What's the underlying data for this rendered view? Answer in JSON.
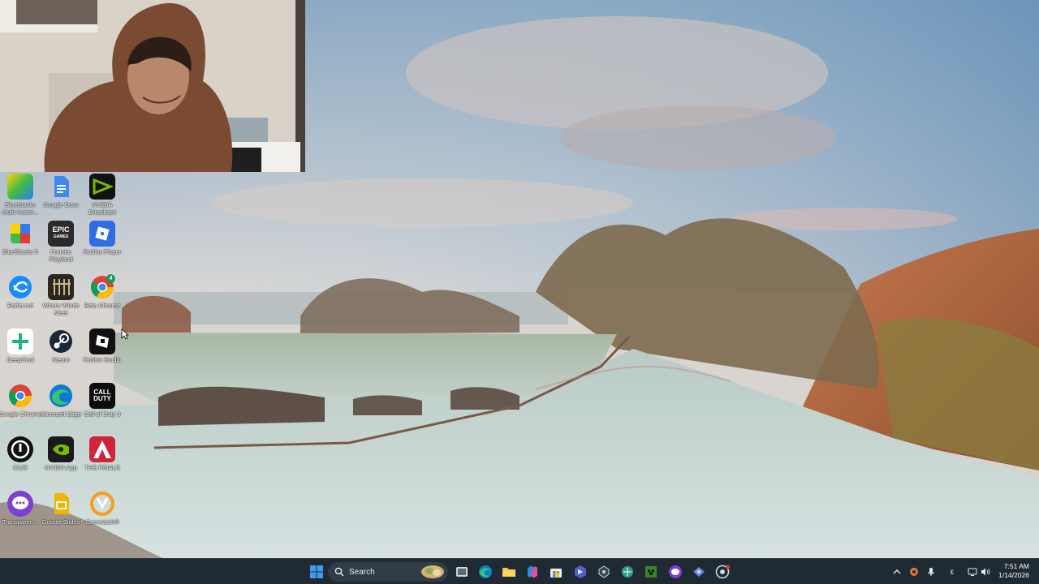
{
  "desktop": {
    "icons": [
      {
        "label": "BlueStacks Multi-Instan...",
        "icon": "bluestacks-multi-icon"
      },
      {
        "label": "Google Docs",
        "icon": "google-docs-icon"
      },
      {
        "label": "NVIDIA Broadcast",
        "icon": "nvidia-broadcast-icon"
      },
      {
        "label": "BlueStacks 5",
        "icon": "bluestacks-icon"
      },
      {
        "label": "Fortnite Playland",
        "icon": "epic-games-icon"
      },
      {
        "label": "Roblox Player",
        "icon": "roblox-player-icon"
      },
      {
        "label": "Battle.net",
        "icon": "battlenet-icon"
      },
      {
        "label": "Where Winds Meet",
        "icon": "where-winds-meet-icon"
      },
      {
        "label": "Beta Chrome",
        "icon": "chrome-beta-icon"
      },
      {
        "label": "DeepCool",
        "icon": "deepcool-icon"
      },
      {
        "label": "Steam",
        "icon": "steam-icon"
      },
      {
        "label": "Roblox Studio",
        "icon": "roblox-studio-icon"
      },
      {
        "label": "Google Chrome",
        "icon": "google-chrome-icon"
      },
      {
        "label": "Microsoft Edge",
        "icon": "microsoft-edge-icon"
      },
      {
        "label": "Call of Duty 3",
        "icon": "call-of-duty-icon"
      },
      {
        "label": "iCUE",
        "icon": "icue-icon"
      },
      {
        "label": "NVIDIA App",
        "icon": "nvidia-app-icon"
      },
      {
        "label": "THE FINALS",
        "icon": "the-finals-icon"
      },
      {
        "label": "Transparen...",
        "icon": "transparent-app-icon"
      },
      {
        "label": "Google Slides",
        "icon": "google-slides-icon"
      },
      {
        "label": "Overwatch®",
        "icon": "overwatch-icon"
      }
    ],
    "tile_text": {
      "epic": "EPIC",
      "epic_sub": "GAMES",
      "cod": "CALL\nDUTY",
      "chrome_badge": "4"
    }
  },
  "taskbar": {
    "search_placeholder": "Search",
    "pinned": [
      "start-icon",
      "file-explorer-like-app-icon",
      "microsoft-edge-icon",
      "file-explorer-icon",
      "copilot-icon",
      "microsoft-store-icon",
      "app-icon-a",
      "app-icon-b",
      "app-icon-c",
      "minecraft-icon",
      "app-icon-d",
      "app-icon-e",
      "chrome-taskbar-icon"
    ],
    "clock": {
      "time": "7:51 AM",
      "date": "1/14/2026"
    },
    "tray": {
      "language": "ε"
    }
  },
  "colors": {
    "taskbar_bg": "#1f2a33",
    "accent": "#3b8fe0"
  }
}
